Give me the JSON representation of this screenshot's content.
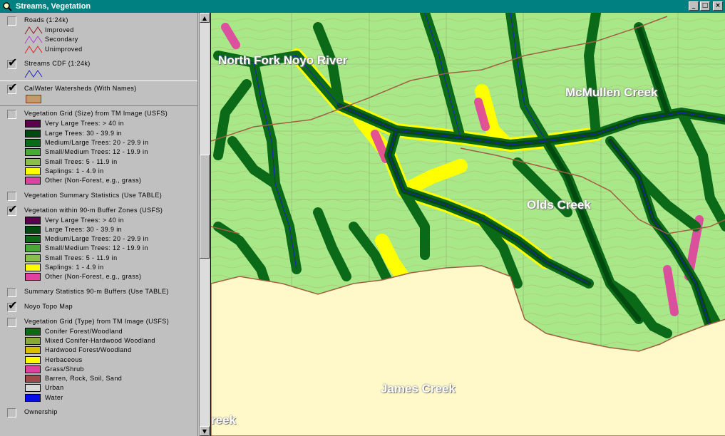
{
  "window": {
    "title": "Streams, Vegetation",
    "buttons": {
      "minimize": "_",
      "maximize": "□",
      "close": "×"
    }
  },
  "legend": {
    "roads": {
      "name": "Roads (1:24k)",
      "checked": false,
      "classes": [
        {
          "label": "Improved",
          "color": "#8b1a1a"
        },
        {
          "label": "Secondary",
          "color": "#b040d0"
        },
        {
          "label": "Unimproved",
          "color": "#e02020"
        }
      ]
    },
    "streams": {
      "name": "Streams CDF (1:24k)",
      "checked": true,
      "color": "#2020c0"
    },
    "watersheds": {
      "name": "CalWater Watersheds (With Names)",
      "checked": true,
      "color": "#c49a6c"
    },
    "veg_size": {
      "name": "Vegetation Grid (Size) from TM Image (USFS)",
      "checked": false,
      "classes": [
        {
          "label": "Very Large Trees: > 40  in",
          "color": "#5a004a"
        },
        {
          "label": "Large Trees: 30 - 39.9 in",
          "color": "#004a10"
        },
        {
          "label": "Medium/Large Trees: 20 - 29.9 in",
          "color": "#0a6a18"
        },
        {
          "label": "Small/Medium Trees: 12 - 19.9 in",
          "color": "#4aa838"
        },
        {
          "label": "Small Trees: 5 - 11.9 in",
          "color": "#8ac04a"
        },
        {
          "label": "Saplings: 1 - 4.9 in",
          "color": "#ffff00"
        },
        {
          "label": "Other (Non-Forest, e.g., grass)",
          "color": "#e040a0"
        }
      ]
    },
    "veg_summary": {
      "name": "Vegetation Summary Statistics (Use TABLE)",
      "checked": false
    },
    "veg_buffer": {
      "name": "Vegetation within 90-m Buffer Zones (USFS)",
      "checked": true,
      "classes": [
        {
          "label": "Very Large Trees: > 40  in",
          "color": "#5a004a"
        },
        {
          "label": "Large Trees: 30 - 39.9 in",
          "color": "#004a10"
        },
        {
          "label": "Medium/Large Trees: 20 - 29.9 in",
          "color": "#0a6a18"
        },
        {
          "label": "Small/Medium Trees: 12 - 19.9 in",
          "color": "#4aa838"
        },
        {
          "label": "Small Trees: 5 - 11.9 in",
          "color": "#8ac04a"
        },
        {
          "label": "Saplings: 1 - 4.9 in",
          "color": "#ffff00"
        },
        {
          "label": "Other (Non-Forest, e.g., grass)",
          "color": "#e040a0"
        }
      ]
    },
    "buffer_summary": {
      "name": "Summary Statistics 90-m Buffers (Use TABLE)",
      "checked": false
    },
    "topo": {
      "name": "Noyo Topo Map",
      "checked": true
    },
    "veg_type": {
      "name": "Vegetation Grid (Type) from TM Image (USFS)",
      "checked": false,
      "classes": [
        {
          "label": "Conifer Forest/Woodland",
          "color": "#0a6a18"
        },
        {
          "label": "Mixed Conifer-Hardwood Woodland",
          "color": "#8aa838"
        },
        {
          "label": "Hardwood Forest/Woodland",
          "color": "#d8c000"
        },
        {
          "label": "Herbaceous",
          "color": "#ffff00"
        },
        {
          "label": "Grass/Shrub",
          "color": "#e040a0"
        },
        {
          "label": "Barren, Rock, Soil, Sand",
          "color": "#a04848"
        },
        {
          "label": "Urban",
          "color": "#d8d8d8"
        },
        {
          "label": "Water",
          "color": "#0010e0"
        }
      ]
    },
    "ownership": {
      "name": "Ownership",
      "checked": false
    }
  },
  "map": {
    "labels": {
      "north_fork": "North Fork Noyo River",
      "mcmullen": "McMullen Creek",
      "olds": "Olds Creek",
      "james": "James Creek",
      "partial": "reek"
    },
    "colors": {
      "background": "#a8e888",
      "outside": "#fff8c8",
      "stream": "#2020c0",
      "watershed": "#a06040"
    }
  }
}
